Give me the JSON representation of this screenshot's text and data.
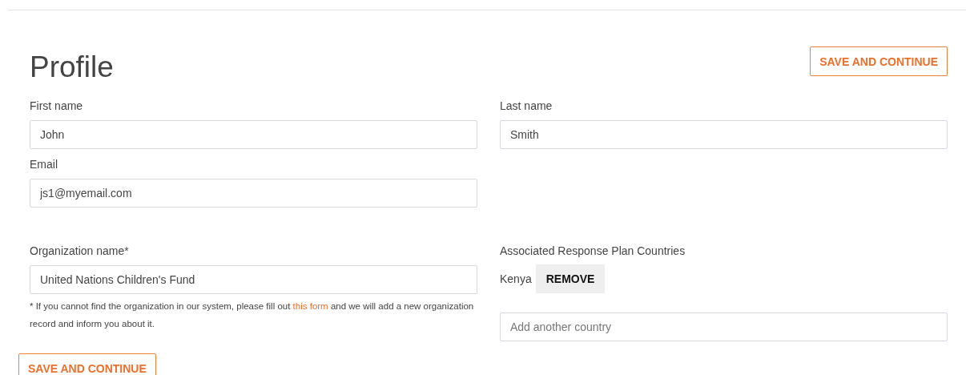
{
  "title": "Profile",
  "top_button": "SAVE AND CONTINUE",
  "fields": [
    {
      "label": "First name",
      "value": "John"
    },
    {
      "label": "Last name",
      "value": "Smith"
    },
    {
      "label": "Email",
      "value": "js1@myemail.com"
    }
  ],
  "organization": {
    "label": "Organization name*",
    "value": "United Nations Children's Fund",
    "note_before": "* If you cannot find the organization in our system, please fill out",
    "note_link": "this form",
    "note_after": "and we will add a new organization record and inform you about it."
  },
  "countries": {
    "label": "Associated Response Plan Countries",
    "items": [
      {
        "name": "Kenya",
        "action": "REMOVE"
      }
    ],
    "placeholder": "Add another country"
  },
  "bottom_button": "SAVE AND CONTINUE"
}
